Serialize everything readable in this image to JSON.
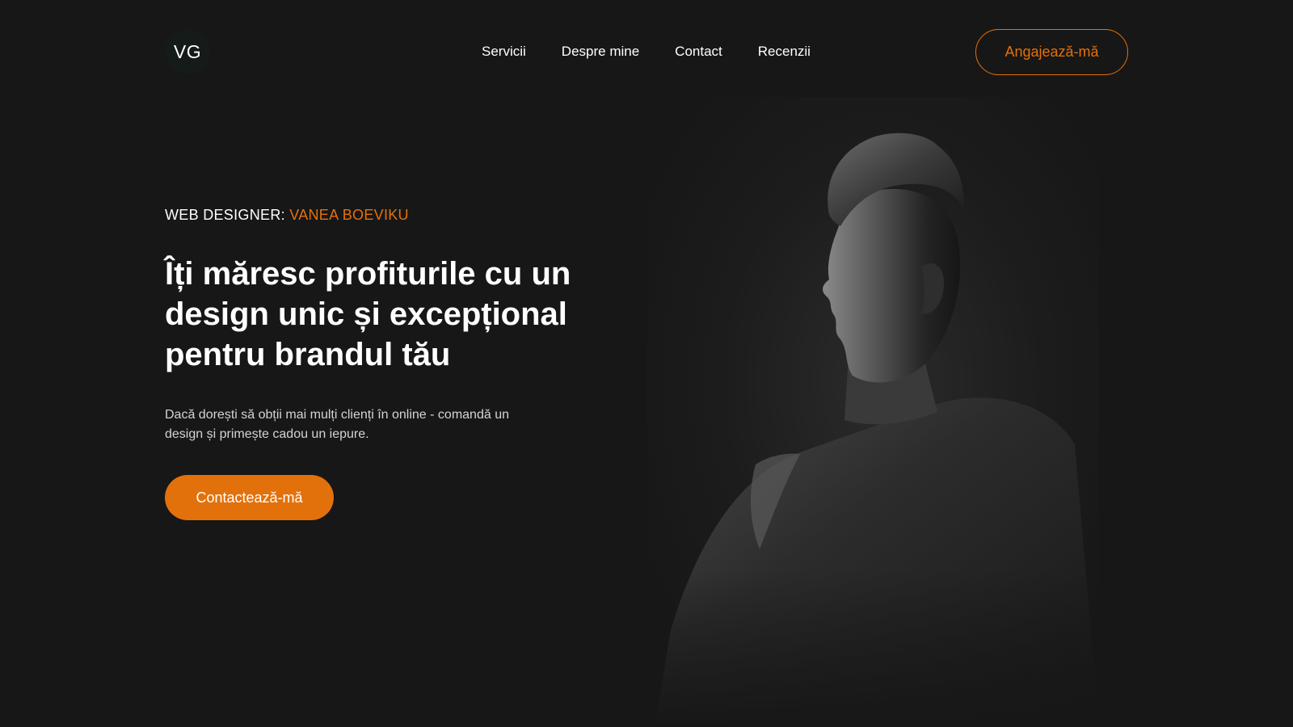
{
  "header": {
    "logo_text": "VG",
    "nav": [
      {
        "label": "Servicii"
      },
      {
        "label": "Despre mine"
      },
      {
        "label": "Contact"
      },
      {
        "label": "Recenzii"
      }
    ],
    "hire_label": "Angajează-mă"
  },
  "hero": {
    "eyebrow_prefix": "WEB DESIGNER: ",
    "eyebrow_name": "VANEA BOEVIKU",
    "headline": "Îți măresc profiturile cu un design unic și excepțional pentru brandul tău",
    "lead": "Dacă dorești să obții mai mulți clienți în online - comandă un design și primește cadou un iepure.",
    "cta_label": "Contactează-mă"
  },
  "colors": {
    "background": "#171717",
    "accent": "#e3710b",
    "logo_bg": "#141b18",
    "text": "#ffffff"
  },
  "portrait": {
    "icon": "man-profile-portrait"
  }
}
